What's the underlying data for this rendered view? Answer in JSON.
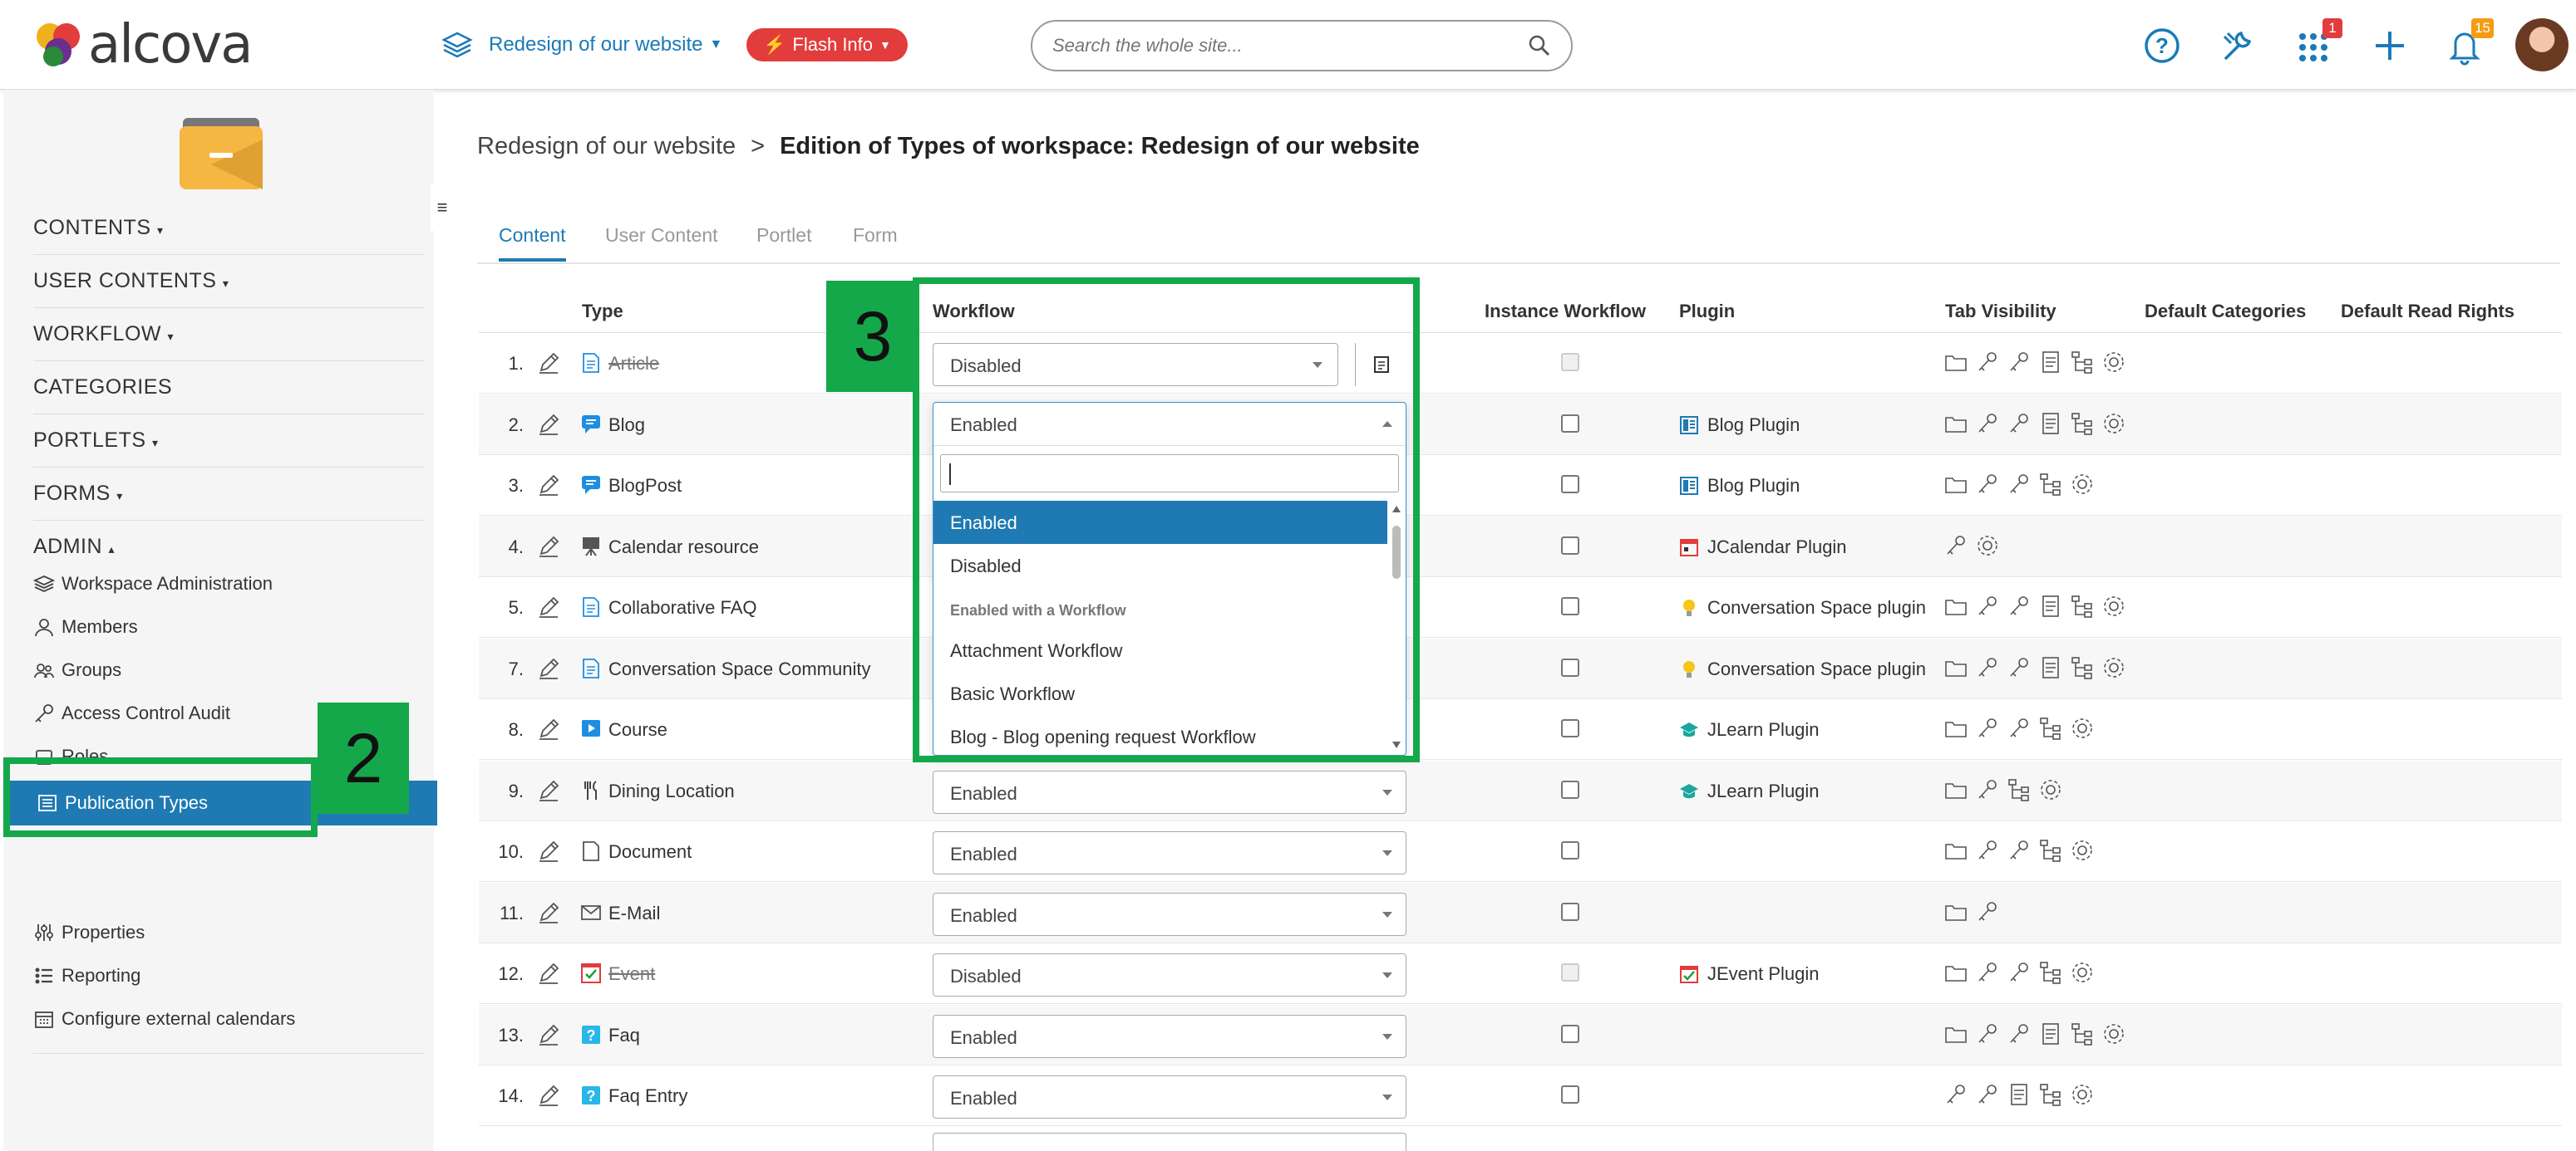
{
  "app": {
    "logo_text": "alcova",
    "logo_icon": "alcova-logo-icon"
  },
  "header": {
    "workspace_selector": "Redesign of our website",
    "flash_button": "Flash Info",
    "search_placeholder": "Search the whole site...",
    "icons": {
      "help": "help-circle-icon",
      "tools": "wrench-icon",
      "apps": "apps-grid-icon",
      "add": "plus-icon",
      "notifications": "bell-icon"
    },
    "apps_badge": "1",
    "notifications_badge": "15",
    "colors": {
      "accent": "#1f7ab3",
      "flash": "#e23c3c",
      "apps_badge": "#e23c3c",
      "notif_badge": "#f39c12"
    }
  },
  "sidebar": {
    "sections": [
      {
        "label": "CONTENTS",
        "caret": "▾"
      },
      {
        "label": "USER CONTENTS",
        "caret": "▾"
      },
      {
        "label": "WORKFLOW",
        "caret": "▾"
      },
      {
        "label": "CATEGORIES",
        "caret": ""
      },
      {
        "label": "PORTLETS",
        "caret": "▾"
      },
      {
        "label": "FORMS",
        "caret": "▾"
      },
      {
        "label": "ADMIN",
        "caret": "▴"
      }
    ],
    "admin_items": [
      {
        "label": "Workspace Administration",
        "icon": "layers-icon"
      },
      {
        "label": "Members",
        "icon": "user-icon"
      },
      {
        "label": "Groups",
        "icon": "group-icon"
      },
      {
        "label": "Access Control Audit",
        "icon": "key-icon"
      },
      {
        "label": "Roles",
        "icon": "roles-icon"
      },
      {
        "label": "Publication Types",
        "icon": "list-icon",
        "active": true
      },
      {
        "label": "Properties",
        "icon": "sliders-icon"
      },
      {
        "label": "Reporting",
        "icon": "report-list-icon"
      },
      {
        "label": "Configure external calendars",
        "icon": "calendar-icon"
      }
    ]
  },
  "breadcrumb": {
    "parent": "Redesign of our website",
    "separator": ">",
    "current": "Edition of Types of workspace: Redesign of our website"
  },
  "tabs": [
    {
      "label": "Content",
      "active": true
    },
    {
      "label": "User Content"
    },
    {
      "label": "Portlet"
    },
    {
      "label": "Form"
    }
  ],
  "table": {
    "columns": [
      "Type",
      "Workflow",
      "Instance Workflow",
      "Plugin",
      "Tab Visibility",
      "Default Categories",
      "Default Read Rights"
    ],
    "rows": [
      {
        "num": "1.",
        "type": "Article",
        "strike": true,
        "workflow": "Disabled",
        "disabled_check": true,
        "plugin": "",
        "vis": [
          "folder",
          "key",
          "key",
          "doc",
          "tree",
          "gear"
        ]
      },
      {
        "num": "2.",
        "type": "Blog",
        "workflow": "Enabled",
        "plugin": "Blog Plugin",
        "vis": [
          "folder",
          "key",
          "key",
          "doc",
          "tree",
          "gear"
        ]
      },
      {
        "num": "3.",
        "type": "BlogPost",
        "workflow": "",
        "plugin": "Blog Plugin",
        "vis": [
          "folder",
          "key",
          "key",
          "tree",
          "gear"
        ]
      },
      {
        "num": "4.",
        "type": "Calendar resource",
        "workflow": "",
        "plugin": "JCalendar Plugin",
        "vis": [
          "key",
          "gear"
        ]
      },
      {
        "num": "5.",
        "type": "Collaborative FAQ",
        "workflow": "",
        "plugin": "Conversation Space plugin",
        "vis": [
          "folder",
          "key",
          "key",
          "doc",
          "tree",
          "gear"
        ]
      },
      {
        "num": "7.",
        "type": "Conversation Space Community",
        "workflow": "",
        "plugin": "Conversation Space plugin",
        "vis": [
          "folder",
          "key",
          "key",
          "doc",
          "tree",
          "gear"
        ]
      },
      {
        "num": "8.",
        "type": "Course",
        "workflow": "",
        "plugin": "JLearn Plugin",
        "vis": [
          "folder",
          "key",
          "key",
          "tree",
          "gear"
        ]
      },
      {
        "num": "9.",
        "type": "Dining Location",
        "workflow": "Enabled",
        "plugin": "JLearn Plugin",
        "vis": [
          "folder",
          "key",
          "tree",
          "gear"
        ]
      },
      {
        "num": "10.",
        "type": "Document",
        "workflow": "Enabled",
        "plugin": "",
        "vis": [
          "folder",
          "key",
          "key",
          "tree",
          "gear"
        ]
      },
      {
        "num": "11.",
        "type": "E-Mail",
        "workflow": "Enabled",
        "plugin": "",
        "vis": [
          "folder",
          "key"
        ]
      },
      {
        "num": "12.",
        "type": "Event",
        "strike": true,
        "workflow": "Disabled",
        "disabled_check": true,
        "plugin": "JEvent Plugin",
        "vis": [
          "folder",
          "key",
          "key",
          "tree",
          "gear"
        ]
      },
      {
        "num": "13.",
        "type": "Faq",
        "workflow": "Enabled",
        "plugin": "",
        "vis": [
          "folder",
          "key",
          "key",
          "doc",
          "tree",
          "gear"
        ]
      },
      {
        "num": "14.",
        "type": "Faq Entry",
        "workflow": "Enabled",
        "plugin": "",
        "vis": [
          "key",
          "key",
          "doc",
          "tree",
          "gear"
        ]
      }
    ]
  },
  "dropdown": {
    "current": "Enabled",
    "options": [
      "Enabled",
      "Disabled"
    ],
    "group_label": "Enabled with a Workflow",
    "group_options": [
      "Attachment Workflow",
      "Basic Workflow",
      "Blog - Blog opening request Workflow"
    ]
  },
  "annotations": {
    "step2": "2",
    "step3": "3",
    "color": "#15a84a"
  }
}
